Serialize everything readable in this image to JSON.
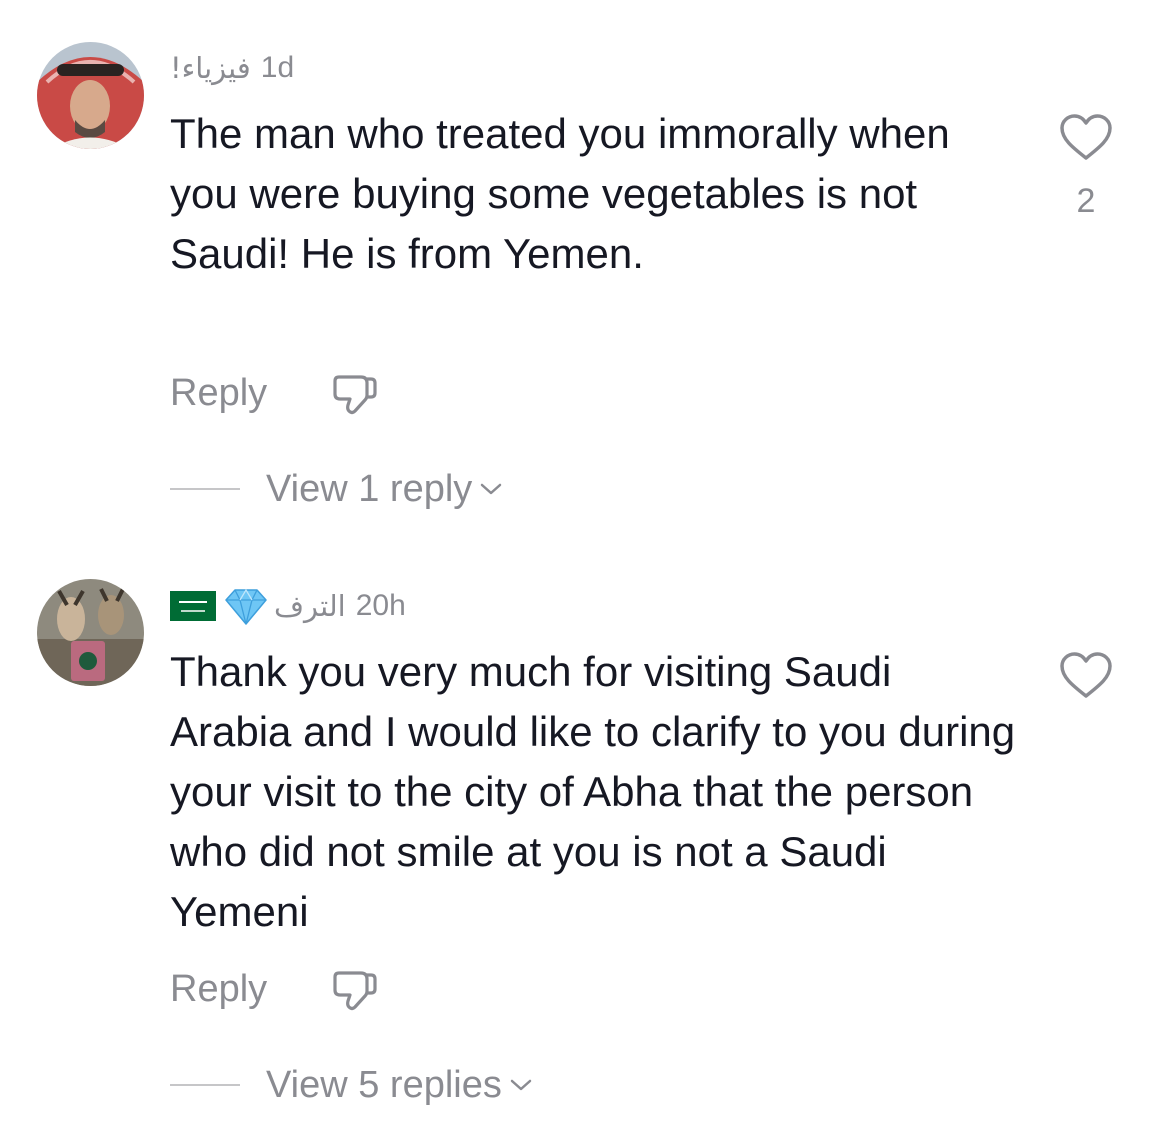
{
  "comments": [
    {
      "username": "فيزياء!",
      "time": "1d",
      "text": "The man who treated you immorally when you were buying some vegetables is not Saudi! He is from Yemen.",
      "like_count": "2",
      "reply_label": "Reply",
      "view_replies_label": "View 1 reply",
      "avatar_icon": "avatar-man-red-ghutra",
      "badges": []
    },
    {
      "username": "الترف",
      "time": "20h",
      "text": "Thank you very much for visiting Saudi Arabia and I would like to clarify to you during your visit to the city of Abha that the person who did not smile at you is not a Saudi Yemeni",
      "like_count": "",
      "reply_label": "Reply",
      "view_replies_label": "View 5 replies",
      "avatar_icon": "avatar-goats-cup",
      "badges": [
        "gem-icon",
        "saudi-flag-icon"
      ]
    }
  ],
  "colors": {
    "text_primary": "#161823",
    "text_secondary": "#8a8b91",
    "divider": "#c6c6c8",
    "flag_green": "#006c35"
  }
}
